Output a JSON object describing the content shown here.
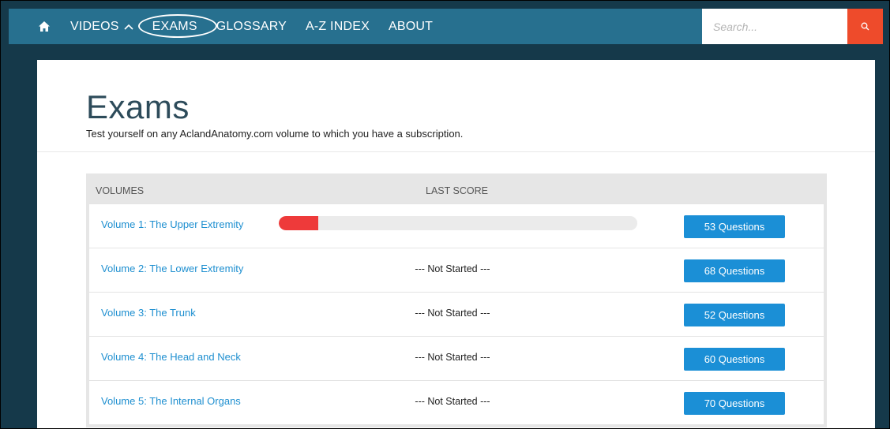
{
  "nav": {
    "items": [
      {
        "label": "VIDEOS"
      },
      {
        "label": "EXAMS"
      },
      {
        "label": "GLOSSARY"
      },
      {
        "label": "A-Z INDEX"
      },
      {
        "label": "ABOUT"
      }
    ],
    "home_icon": "home-icon",
    "videos_icon": "chevron-up-icon",
    "search_placeholder": "Search...",
    "search_icon": "search-icon",
    "colors": {
      "nav_bg": "#27708f",
      "search_btn": "#ee4b2b"
    }
  },
  "page": {
    "title": "Exams",
    "subtitle": "Test yourself on any AclandAnatomy.com volume to which you have a subscription."
  },
  "table": {
    "headers": {
      "volumes": "VOLUMES",
      "last_score": "LAST SCORE"
    },
    "rows": [
      {
        "volume": "Volume 1: The Upper Extremity",
        "score_fraction": 0.11,
        "status": "",
        "questions": "53 Questions"
      },
      {
        "volume": "Volume 2: The Lower Extremity",
        "status": "--- Not Started ---",
        "questions": "68 Questions"
      },
      {
        "volume": "Volume 3: The Trunk",
        "status": "--- Not Started ---",
        "questions": "52 Questions"
      },
      {
        "volume": "Volume 4: The Head and Neck",
        "status": "--- Not Started ---",
        "questions": "60 Questions"
      },
      {
        "volume": "Volume 5: The Internal Organs",
        "status": "--- Not Started ---",
        "questions": "70 Questions"
      }
    ],
    "colors": {
      "link": "#1e8fd0",
      "button": "#1b8fd6",
      "score_fill": "#ee3a3a"
    }
  }
}
